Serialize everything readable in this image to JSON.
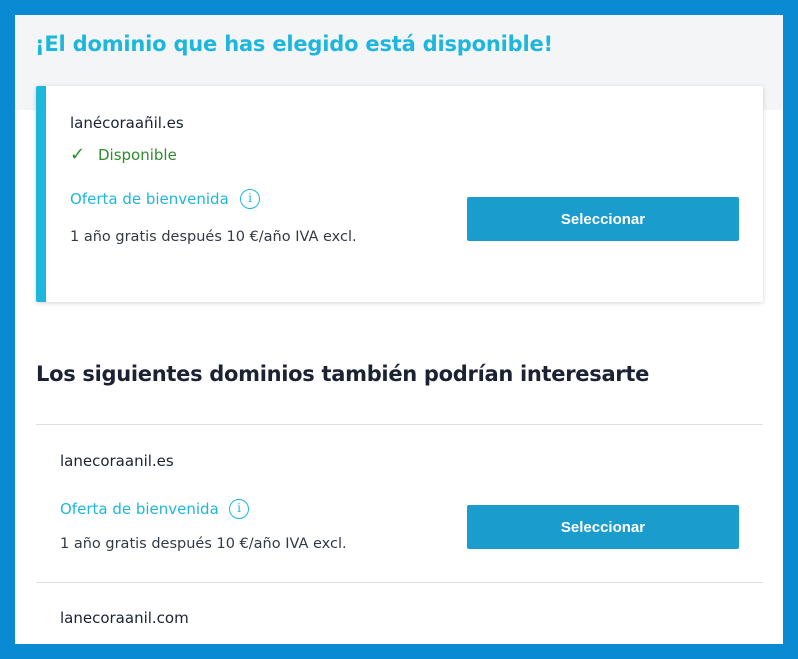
{
  "headline": "¡El dominio que has elegido está disponible!",
  "selected_domain": {
    "name": "lanécoraañil.es",
    "status": "Disponible",
    "status_icon": "checkmark-icon",
    "offer_label": "Oferta de bienvenida",
    "info_icon": "i",
    "price_text": "1 año gratis después  10 €/año IVA excl.",
    "button_label": "Seleccionar"
  },
  "suggestions_title": "Los siguientes dominios también podrían interesarte",
  "suggestions": [
    {
      "name": "lanecoraanil.es",
      "offer_label": "Oferta de bienvenida",
      "info_icon": "i",
      "price_text": "1 año gratis después 10 €/año IVA excl.",
      "button_label": "Seleccionar"
    },
    {
      "name": "lanecoraanil.com"
    }
  ],
  "colors": {
    "frame_border": "#0b8ad4",
    "accent": "#1fb6dc",
    "button": "#1a9dcc",
    "available": "#2e8b2e"
  }
}
